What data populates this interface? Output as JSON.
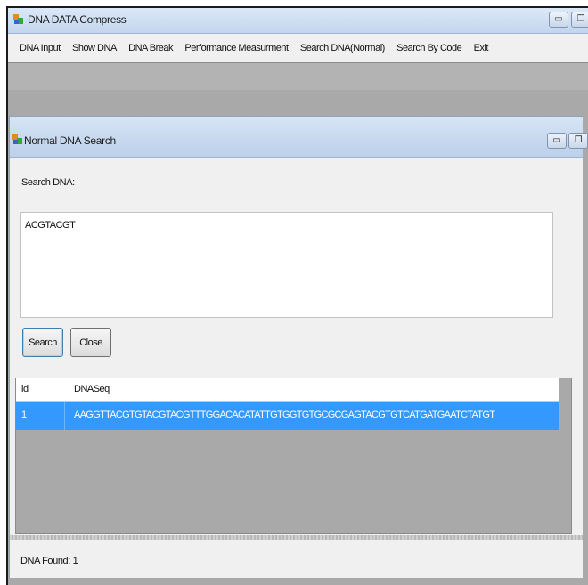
{
  "app": {
    "title": "DNA DATA Compress",
    "window_buttons": {
      "minimize": "▭",
      "restore": "❐"
    }
  },
  "menu": {
    "items": [
      "DNA Input",
      "Show DNA",
      "DNA Break",
      "Performance Measurment",
      "Search DNA(Normal)",
      "Search By Code",
      "Exit"
    ]
  },
  "child": {
    "title": "Normal DNA Search",
    "search_label": "Search DNA:",
    "search_value": "ACGTACGT",
    "search_button": "Search",
    "close_button": "Close"
  },
  "grid": {
    "columns": [
      "id",
      "DNASeq"
    ],
    "rows": [
      {
        "id": "1",
        "seq": "AAGGTTACGTGTACGTACGTTTGGACACATATTGTGGTGTGCGCGAGTACGTGTCATGATGAATCTATGT",
        "selected": true
      }
    ]
  },
  "status": {
    "text": "DNA Found: 1"
  },
  "colors": {
    "selection": "#3399ff",
    "mdi_background": "#a9a9a9",
    "titlebar": "#c3d6ee"
  }
}
